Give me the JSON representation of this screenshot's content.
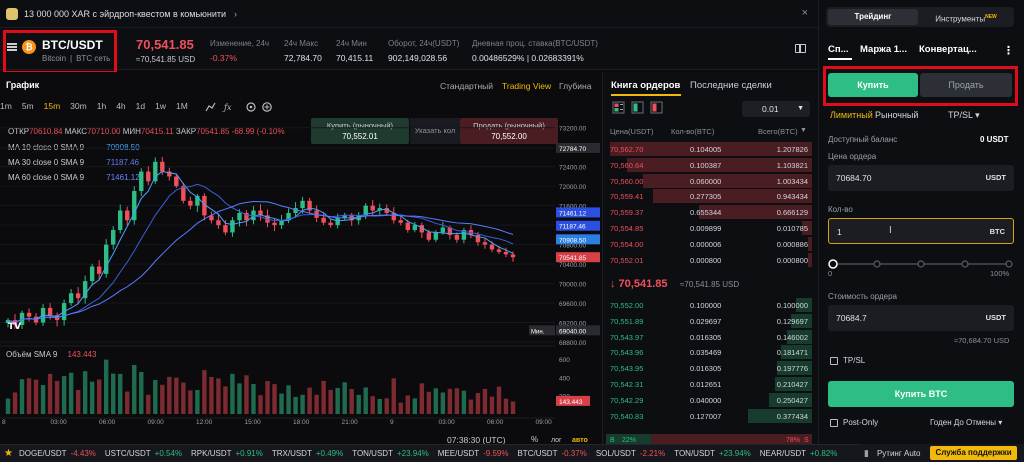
{
  "announcement": {
    "text": "13 000 000 XAR с эйрдроп-квестом в комьюнити",
    "chevron": "›",
    "close": "×"
  },
  "header": {
    "pair": "BTC/USDT",
    "coin": "Bitcoin",
    "network": "BTC сеть",
    "coin_letter": "₿",
    "last_price": "70,541.85",
    "last_price_usd": "≈70,541.85 USD",
    "stats": [
      {
        "label": "Изменение, 24ч",
        "value": "-0.37%"
      },
      {
        "label": "24ч Макс",
        "value": "72,784.70"
      },
      {
        "label": "24ч Мин",
        "value": "70,415.11"
      },
      {
        "label": "Оборот, 24ч(USDT)",
        "value": "902,149,028.56"
      },
      {
        "label": "Дневная проц. ставка(BTC/USDT)",
        "value": "0.00486529% | 0.02683391%"
      }
    ]
  },
  "chart": {
    "title": "График",
    "views": [
      "Стандартный",
      "Trading View",
      "Глубина"
    ],
    "timeframes": [
      "1m",
      "5m",
      "15m",
      "30m",
      "1h",
      "4h",
      "1d",
      "1w",
      "1M"
    ],
    "active_timeframe": "15m",
    "ohlc": {
      "o_lbl": "ОТКР",
      "o": "70610.84",
      "h_lbl": "МАКС",
      "h": "70710.00",
      "l_lbl": "МИН",
      "l": "70415.11",
      "c_lbl": "ЗАКР",
      "c": "70541.85",
      "chg": "-68.99 (-0.10%"
    },
    "ma": [
      {
        "label": "MA 10 close 0 SMA 9",
        "value": "70908.50",
        "color": "#4aa3ff"
      },
      {
        "label": "MA 30 close 0 SMA 9",
        "value": "71187.46",
        "color": "#3a6fe8"
      },
      {
        "label": "MA 60 close 0 SMA 9",
        "value": "71461.12",
        "color": "#5a7cff"
      }
    ],
    "quick_buy": {
      "label": "Купить (рыночный)",
      "price": "70,552.01"
    },
    "quick_mid": "Указать кол",
    "quick_sell": {
      "label": "Продать (рыночный)",
      "price": "70,552.00"
    },
    "volume_label": "Объём SMA 9",
    "volume_value": "143.443",
    "tv_logo": "TV",
    "time_display": "07:38:30 (UTC)",
    "bottom_tools": [
      "%",
      "лог",
      "авто"
    ]
  },
  "chart_data": {
    "type": "candlestick",
    "price_axis": [
      "73200.00",
      "72784.70",
      "72400.00",
      "72000.00",
      "71600.00",
      "71200.00",
      "70800.00",
      "70400.00",
      "70000.00",
      "69600.00",
      "69200.00",
      "68800.00"
    ],
    "ylim": [
      68800,
      73400
    ],
    "price_tags": [
      {
        "value": "72784.70",
        "type": "max",
        "color": "#2a2b30"
      },
      {
        "value": "71461.12",
        "color": "#2b4fe0"
      },
      {
        "value": "71187.46",
        "color": "#2b4fe0"
      },
      {
        "value": "70908.50",
        "color": "#2b7fe0"
      },
      {
        "value": "70541.85",
        "color": "#d84048"
      },
      {
        "value": "69040.00",
        "type": "min",
        "label": "Мин.",
        "color": "#2a2b30"
      }
    ],
    "volume_axis": [
      "600",
      "400",
      "200"
    ],
    "volume_tag": "143.443",
    "x_ticks": [
      "8",
      "03:00",
      "06:00",
      "09:00",
      "12:00",
      "15:00",
      "18:00",
      "21:00",
      "9",
      "03:00",
      "06:00",
      "09:00"
    ],
    "close_path": [
      69250,
      69150,
      69400,
      69320,
      69200,
      69500,
      69350,
      69250,
      69600,
      69800,
      69700,
      70050,
      70350,
      70200,
      70800,
      71100,
      71500,
      71300,
      71900,
      72300,
      72100,
      72500,
      72300,
      72200,
      72000,
      71700,
      71600,
      71800,
      71400,
      71300,
      71200,
      71050,
      71300,
      71450,
      71300,
      71500,
      71400,
      71250,
      71200,
      71300,
      71450,
      71550,
      71700,
      71500,
      71350,
      71250,
      71200,
      71350,
      71400,
      71300,
      71400,
      71600,
      71500,
      71550,
      71450,
      71300,
      71250,
      71100,
      71200,
      71050,
      70900,
      71050,
      71150,
      71000,
      70900,
      71100,
      71000,
      70850,
      70800,
      70700,
      70650,
      70600,
      70541
    ]
  },
  "orderbook": {
    "tabs": [
      "Книга ордеров",
      "Последние сделки"
    ],
    "step": "0.01",
    "headers": [
      "Цена(USDT)",
      "Кол-во(BTC)",
      "Всего(BTC)"
    ],
    "asks": [
      {
        "p": "70,562.70",
        "a": "0.104005",
        "t": "1.207826",
        "w": 0.98
      },
      {
        "p": "70,560.64",
        "a": "0.100387",
        "t": "1.103821",
        "w": 0.9
      },
      {
        "p": "70,560.00",
        "a": "0.060000",
        "t": "1.003434",
        "w": 0.82
      },
      {
        "p": "70,559.41",
        "a": "0.277305",
        "t": "0.943434",
        "w": 0.77
      },
      {
        "p": "70,559.37",
        "a": "0.655344",
        "t": "0.666129",
        "w": 0.55
      },
      {
        "p": "70,554.85",
        "a": "0.009899",
        "t": "0.010785",
        "w": 0.05
      },
      {
        "p": "70,554.00",
        "a": "0.000006",
        "t": "0.000886",
        "w": 0.02
      },
      {
        "p": "70,552.01",
        "a": "0.000800",
        "t": "0.000800",
        "w": 0.02
      }
    ],
    "mid_price": "↓ 70,541.85",
    "mid_usd": "≈70,541.85 USD",
    "bids": [
      {
        "p": "70,552.00",
        "a": "0.100000",
        "t": "0.100000",
        "w": 0.08
      },
      {
        "p": "70,551.89",
        "a": "0.029697",
        "t": "0.129697",
        "w": 0.1
      },
      {
        "p": "70,543.97",
        "a": "0.016305",
        "t": "0.146002",
        "w": 0.12
      },
      {
        "p": "70,543.96",
        "a": "0.035469",
        "t": "0.181471",
        "w": 0.15
      },
      {
        "p": "70,543.95",
        "a": "0.016305",
        "t": "0.197776",
        "w": 0.17
      },
      {
        "p": "70,542.31",
        "a": "0.012651",
        "t": "0.210427",
        "w": 0.18
      },
      {
        "p": "70,542.29",
        "a": "0.040000",
        "t": "0.250427",
        "w": 0.21
      },
      {
        "p": "70,540.83",
        "a": "0.127007",
        "t": "0.377434",
        "w": 0.31
      }
    ],
    "ratio_buy_label": "B",
    "ratio_buy": "22%",
    "ratio_sell": "78%",
    "ratio_sell_label": "S"
  },
  "trade": {
    "mode_tabs": [
      "Трейдинг",
      "Инструменты"
    ],
    "mode_new_badge": "NEW",
    "account_tabs": [
      "Сп...",
      "Маржа 1...",
      "Конвертац..."
    ],
    "kebab": "⋮",
    "buy_tab": "Купить",
    "sell_tab": "Продать",
    "order_types": [
      "Лимитный",
      "Рыночный",
      "TP/SL ▾"
    ],
    "balance_label": "Доступный баланс",
    "balance_value": "0 USDT",
    "price_label": "Цена ордера",
    "price_value": "70684.70",
    "price_unit": "USDT",
    "qty_label": "Кол-во",
    "qty_value": "1",
    "qty_unit": "BTC",
    "slider_min": "0",
    "slider_max": "100%",
    "cost_label": "Стоимость ордера",
    "cost_value": "70684.7",
    "cost_unit": "USDT",
    "cost_usd": "≈70,684.70 USD",
    "tpsl_label": "TP/SL",
    "buy_button": "Купить BTC",
    "postonly_label": "Post-Only",
    "tif": "Годен До Отмены ▾"
  },
  "ticker": {
    "items": [
      {
        "sym": "DOGE/USDT",
        "chg": "-4.43%",
        "dir": "neg"
      },
      {
        "sym": "USTC/USDT",
        "chg": "+0.54%",
        "dir": "pos"
      },
      {
        "sym": "RPK/USDT",
        "chg": "+0.91%",
        "dir": "pos"
      },
      {
        "sym": "TRX/USDT",
        "chg": "+0.49%",
        "dir": "pos"
      },
      {
        "sym": "TON/USDT",
        "chg": "+23.94%",
        "dir": "pos"
      },
      {
        "sym": "MEE/USDT",
        "chg": "-9.59%",
        "dir": "neg"
      },
      {
        "sym": "BTC/USDT",
        "chg": "-0.37%",
        "dir": "neg"
      },
      {
        "sym": "SOL/USDT",
        "chg": "-2.21%",
        "dir": "neg"
      },
      {
        "sym": "TON/USDT",
        "chg": "+23.94%",
        "dir": "pos"
      },
      {
        "sym": "NEAR/USDT",
        "chg": "+0.82%",
        "dir": "pos"
      }
    ],
    "routing": "Рутинг Auto",
    "support": "Служба поддержки"
  }
}
